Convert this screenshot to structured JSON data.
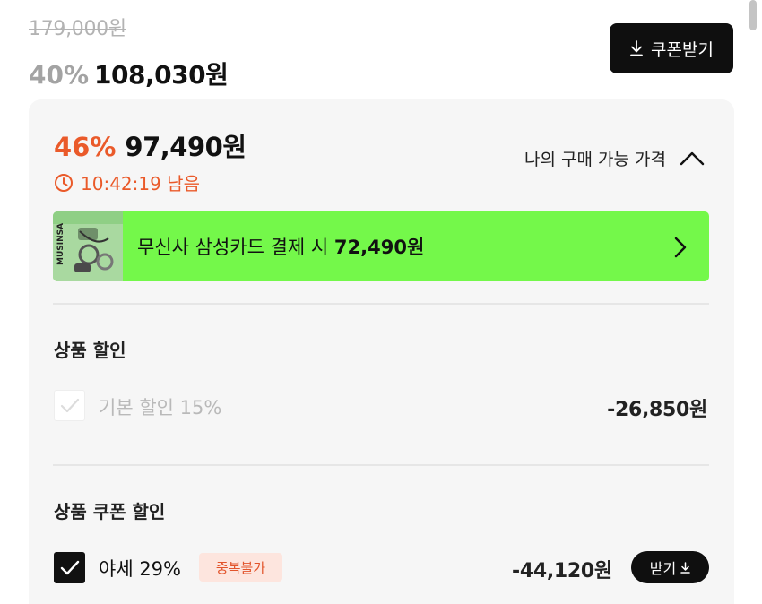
{
  "price": {
    "original": "179,000원",
    "discount_rate": "40%",
    "sale_price": "108,030원"
  },
  "coupon_button": {
    "label": "쿠폰받기",
    "icon": "download-icon"
  },
  "my_price": {
    "rate": "46%",
    "price": "97,490원",
    "timer_text": "10:42:19 남음",
    "timer_icon": "clock-icon",
    "toggle_label": "나의 구매 가능 가격",
    "toggle_icon": "chevron-up-icon"
  },
  "card_banner": {
    "text_prefix": "무신사 삼성카드 결제 시",
    "amount": "72,490원",
    "thumb_text": "MUSINSA",
    "chevron_icon": "chevron-right-icon",
    "background": "#74f84a"
  },
  "product_discount": {
    "title": "상품 할인",
    "items": [
      {
        "label": "기본 할인 15%",
        "amount": "-26,850원",
        "checked": true,
        "disabled": true
      }
    ]
  },
  "product_coupon": {
    "title": "상품 쿠폰 할인",
    "items": [
      {
        "label": "야세 29%",
        "badge": "중복불가",
        "amount": "-44,120원",
        "checked": true,
        "button": "받기"
      }
    ]
  },
  "colors": {
    "accent": "#ea5a2a",
    "badge_bg": "#fde5de",
    "panel_bg": "#f6f6f6",
    "button_bg": "#0f0f0f"
  }
}
